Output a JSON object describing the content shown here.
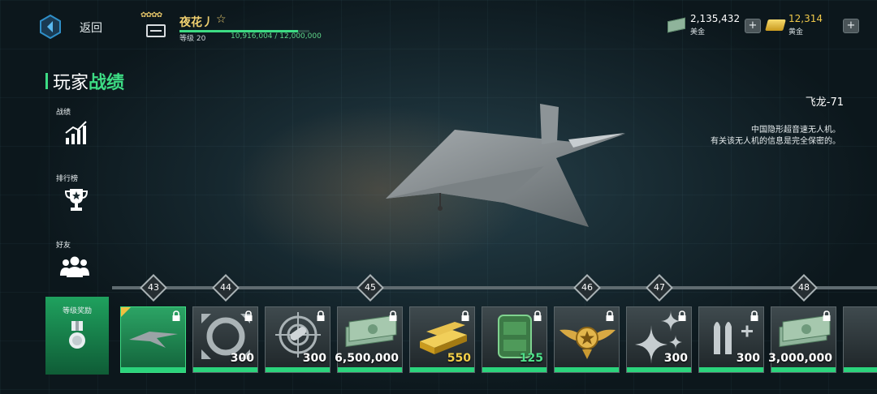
{
  "header": {
    "back_label": "返回",
    "player_name": "夜花丿",
    "level_label": "等级 20",
    "xp_text": "10,916,004 / 12,000,000",
    "xp_progress": 0.91
  },
  "currency": {
    "usd": {
      "amount": "2,135,432",
      "label": "美金"
    },
    "gold": {
      "amount": "12,314",
      "label": "黄金"
    }
  },
  "page_title": {
    "part1": "玩家",
    "part2": "战绩"
  },
  "nav": {
    "stats": "战绩",
    "leaderboard": "排行榜",
    "friends": "好友",
    "level_rewards": "等级奖励"
  },
  "aircraft": {
    "name": "飞龙-71",
    "desc_line1": "中国隐形超音速无人机。",
    "desc_line2": "有关该无人机的信息是完全保密的。"
  },
  "levels": [
    "43",
    "44",
    "45",
    "46",
    "47",
    "48"
  ],
  "rewards": [
    {
      "icon": "drone-icon",
      "amount": ""
    },
    {
      "icon": "repair-icon",
      "amount": "300"
    },
    {
      "icon": "target-missile-icon",
      "amount": "300"
    },
    {
      "icon": "cash-icon",
      "amount": "6,500,000"
    },
    {
      "icon": "gold-bars-icon",
      "amount": "550"
    },
    {
      "icon": "ammo-box-icon",
      "amount": "125"
    },
    {
      "icon": "wing-emblem-icon",
      "amount": ""
    },
    {
      "icon": "sparkle-icon",
      "amount": "300"
    },
    {
      "icon": "ammo-plus-icon",
      "amount": "300"
    },
    {
      "icon": "cash-icon",
      "amount": "3,000,000"
    }
  ],
  "colors": {
    "accent": "#3ddc84",
    "gold_text": "#f0d070",
    "reward_gold": "#f2cf4a",
    "reward_green": "#4ee08a"
  }
}
